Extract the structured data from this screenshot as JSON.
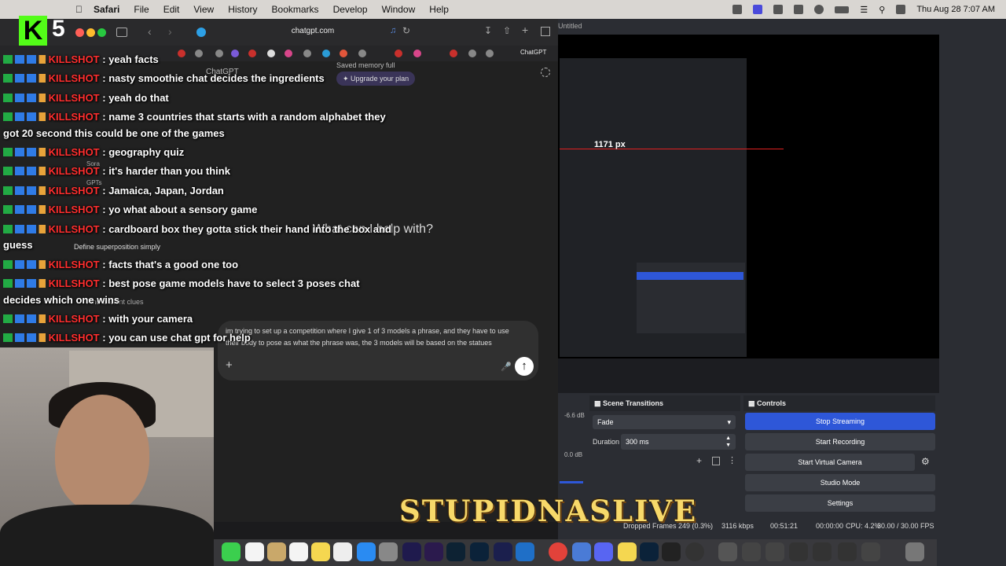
{
  "menubar": {
    "app": "Safari",
    "items": [
      "File",
      "Edit",
      "View",
      "History",
      "Bookmarks",
      "Develop",
      "Window",
      "Help"
    ],
    "datetime": "Thu Aug 28 7:07 AM"
  },
  "browser": {
    "url": "chatgpt.com",
    "favorite_tab": "ChatGPT"
  },
  "chatgpt": {
    "model_label": "ChatGPT",
    "saved_memory": "Saved memory full",
    "upgrade": "Upgrade your plan",
    "heading": "What can I help with?",
    "sidebar_items": [
      "Sora",
      "GPTs",
      "Define superposition simply",
      "Find ancient clues"
    ],
    "prompt_text": "im trying to set up a competition where I give 1 of 3 models a phrase, and they have to use their body to pose as what the phrase was, the 3 models will be based on the statues"
  },
  "chat_messages": [
    {
      "user": "KILLSHOT",
      "text": "yeah facts"
    },
    {
      "user": "KILLSHOT",
      "text": "nasty smoothie chat decides the ingredients"
    },
    {
      "user": "KILLSHOT",
      "text": "yeah do that"
    },
    {
      "user": "KILLSHOT",
      "text": "name 3 countries that starts with a random alphabet they",
      "cont": "got 20 second this could be one of the games"
    },
    {
      "user": "KILLSHOT",
      "text": "geography quiz"
    },
    {
      "user": "KILLSHOT",
      "text": "it's harder than you think"
    },
    {
      "user": "KILLSHOT",
      "text": "Jamaica, Japan, Jordan"
    },
    {
      "user": "KILLSHOT",
      "text": "yo what about a sensory game"
    },
    {
      "user": "KILLSHOT",
      "text": "cardboard box they gotta stick their hand into the box and",
      "cont": "guess"
    },
    {
      "user": "KILLSHOT",
      "text": "facts that's a good one too"
    },
    {
      "user": "KILLSHOT",
      "text": "best pose game models have to select 3 poses chat",
      "cont": "decides which one wins"
    },
    {
      "user": "KILLSHOT",
      "text": "with your camera"
    },
    {
      "user": "KILLSHOT",
      "text": "you can use chat gpt for help"
    }
  ],
  "overlay": {
    "logo_letter": "K",
    "logo_count": "5",
    "brand": "STUPIDNASLIVE"
  },
  "obs": {
    "window_title": "Untitled",
    "measure_label": "1171 px",
    "scene_transitions": {
      "title": "Scene Transitions",
      "transition": "Fade",
      "duration_label": "Duration",
      "duration": "300 ms"
    },
    "audio_db_1": "-6.6 dB",
    "audio_db_2": "0.0 dB",
    "controls": {
      "title": "Controls",
      "buttons": [
        "Stop Streaming",
        "Start Recording",
        "Start Virtual Camera",
        "Studio Mode",
        "Settings"
      ]
    },
    "status": {
      "dropped": "Dropped Frames 249 (0.3%)",
      "bitrate": "3116 kbps",
      "stream_time": "00:51:21",
      "rec_time": "00:00:00",
      "cpu": "CPU: 4.2%",
      "fps": "30.00 / 30.00 FPS"
    }
  },
  "colors": {
    "username": "#ff2e2e",
    "obs_accent": "#2e57d8",
    "brand": "#f7d96a"
  }
}
